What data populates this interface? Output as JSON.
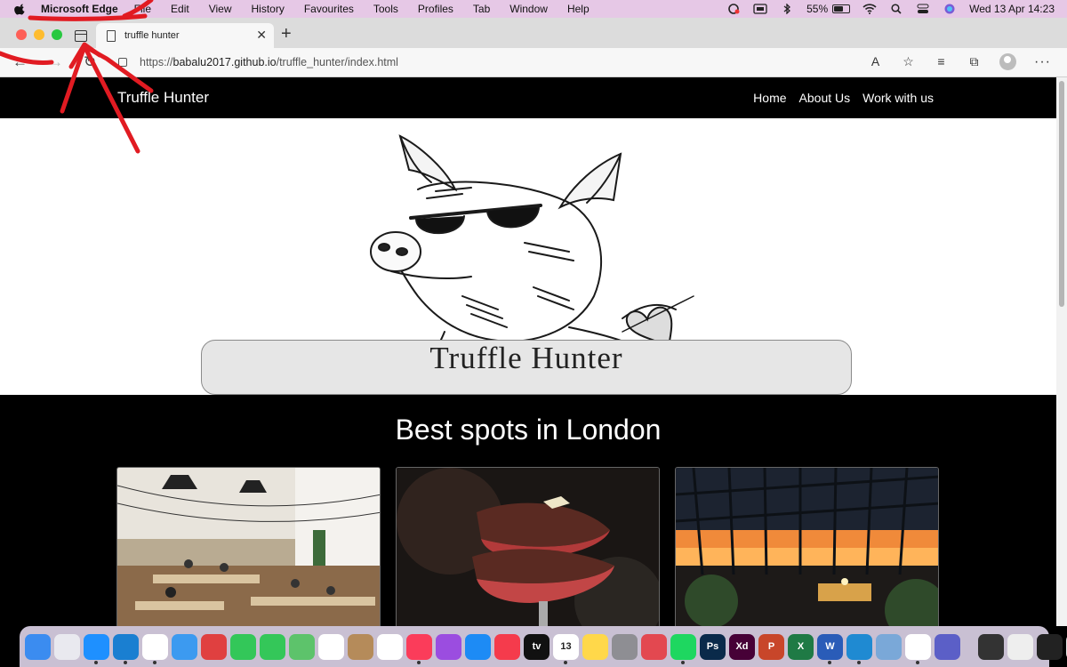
{
  "menubar": {
    "app_name": "Microsoft Edge",
    "items": [
      "File",
      "Edit",
      "View",
      "History",
      "Favourites",
      "Tools",
      "Profiles",
      "Tab",
      "Window",
      "Help"
    ],
    "battery": "55%",
    "datetime": "Wed 13 Apr  14:23"
  },
  "browser": {
    "tab_title": "truffle hunter",
    "url_prefix": "https://",
    "url_host": "babalu2017.github.io",
    "url_path": "/truffle_hunter/index.html",
    "tab_close": "✕",
    "new_tab": "+"
  },
  "site": {
    "brand": "Truffle Hunter",
    "nav": [
      "Home",
      "About Us",
      "Work with us"
    ],
    "hero_text": "Truffle Hunter",
    "section_title": "Best spots in London"
  },
  "dock": {
    "apps": [
      {
        "name": "finder",
        "color": "#3b8cf0",
        "label": ""
      },
      {
        "name": "launchpad",
        "color": "#e9e9ef",
        "label": ""
      },
      {
        "name": "safari",
        "color": "#1e90ff",
        "label": ""
      },
      {
        "name": "edge",
        "color": "#1a7fd1",
        "label": ""
      },
      {
        "name": "chrome",
        "color": "#ffffff",
        "label": ""
      },
      {
        "name": "mail",
        "color": "#3c9af0",
        "label": ""
      },
      {
        "name": "reminders-app",
        "color": "#e04040",
        "label": ""
      },
      {
        "name": "facetime",
        "color": "#33c759",
        "label": ""
      },
      {
        "name": "messages",
        "color": "#34c759",
        "label": ""
      },
      {
        "name": "maps",
        "color": "#5dc36b",
        "label": ""
      },
      {
        "name": "photos",
        "color": "#ffffff",
        "label": ""
      },
      {
        "name": "contacts",
        "color": "#b58b5a",
        "label": ""
      },
      {
        "name": "reminders",
        "color": "#ffffff",
        "label": ""
      },
      {
        "name": "music",
        "color": "#fb3c5a",
        "label": ""
      },
      {
        "name": "podcasts",
        "color": "#9b4de0",
        "label": ""
      },
      {
        "name": "app-store",
        "color": "#1d8bf5",
        "label": ""
      },
      {
        "name": "news",
        "color": "#f53b4c",
        "label": ""
      },
      {
        "name": "tv",
        "color": "#111111",
        "label": "tv"
      },
      {
        "name": "calendar",
        "color": "#ffffff",
        "label": "13"
      },
      {
        "name": "notes",
        "color": "#ffd84a",
        "label": ""
      },
      {
        "name": "system-preferences",
        "color": "#8e8e93",
        "label": ""
      },
      {
        "name": "creative-cloud",
        "color": "#e34850",
        "label": ""
      },
      {
        "name": "spotify",
        "color": "#1ed760",
        "label": ""
      },
      {
        "name": "photoshop",
        "color": "#0a2a4a",
        "label": "Ps"
      },
      {
        "name": "xd",
        "color": "#470137",
        "label": "Xd"
      },
      {
        "name": "powerpoint",
        "color": "#c8462a",
        "label": "P"
      },
      {
        "name": "excel",
        "color": "#1f7a45",
        "label": "X"
      },
      {
        "name": "word",
        "color": "#2a5cb8",
        "label": "W"
      },
      {
        "name": "vscode",
        "color": "#1f8ad2",
        "label": ""
      },
      {
        "name": "preview",
        "color": "#7aa8d8",
        "label": ""
      },
      {
        "name": "emoji",
        "color": "#ffffff",
        "label": ""
      },
      {
        "name": "teams",
        "color": "#5b5fc7",
        "label": ""
      },
      {
        "name": "window-1",
        "color": "#333333",
        "label": ""
      },
      {
        "name": "window-2",
        "color": "#eeeeee",
        "label": ""
      },
      {
        "name": "window-3",
        "color": "#222222",
        "label": ""
      },
      {
        "name": "trash",
        "color": "#e8e8e8",
        "label": ""
      }
    ]
  },
  "colors": {
    "annotation": "#e11b22",
    "menubar": "#e6c8e6",
    "dock": "#c9c0d3"
  }
}
